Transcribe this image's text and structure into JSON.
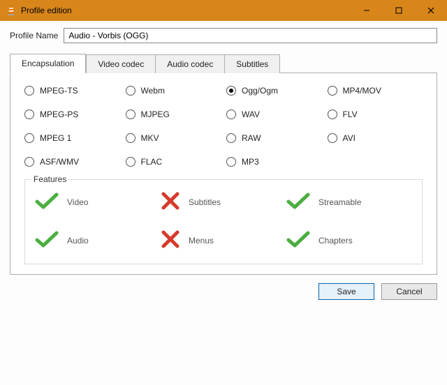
{
  "window": {
    "title": "Profile edition"
  },
  "profile": {
    "label": "Profile Name",
    "value": "Audio - Vorbis (OGG)"
  },
  "tabs": [
    {
      "label": "Encapsulation",
      "active": true
    },
    {
      "label": "Video codec",
      "active": false
    },
    {
      "label": "Audio codec",
      "active": false
    },
    {
      "label": "Subtitles",
      "active": false
    }
  ],
  "encapsulation": {
    "options": [
      {
        "label": "MPEG-TS",
        "checked": false
      },
      {
        "label": "Webm",
        "checked": false
      },
      {
        "label": "Ogg/Ogm",
        "checked": true
      },
      {
        "label": "MP4/MOV",
        "checked": false
      },
      {
        "label": "MPEG-PS",
        "checked": false
      },
      {
        "label": "MJPEG",
        "checked": false
      },
      {
        "label": "WAV",
        "checked": false
      },
      {
        "label": "FLV",
        "checked": false
      },
      {
        "label": "MPEG 1",
        "checked": false
      },
      {
        "label": "MKV",
        "checked": false
      },
      {
        "label": "RAW",
        "checked": false
      },
      {
        "label": "AVI",
        "checked": false
      },
      {
        "label": "ASF/WMV",
        "checked": false
      },
      {
        "label": "FLAC",
        "checked": false
      },
      {
        "label": "MP3",
        "checked": false
      }
    ]
  },
  "features": {
    "legend": "Features",
    "items": [
      {
        "label": "Video",
        "ok": true
      },
      {
        "label": "Subtitles",
        "ok": false
      },
      {
        "label": "Streamable",
        "ok": true
      },
      {
        "label": "Audio",
        "ok": true
      },
      {
        "label": "Menus",
        "ok": false
      },
      {
        "label": "Chapters",
        "ok": true
      }
    ]
  },
  "buttons": {
    "save": "Save",
    "cancel": "Cancel"
  }
}
